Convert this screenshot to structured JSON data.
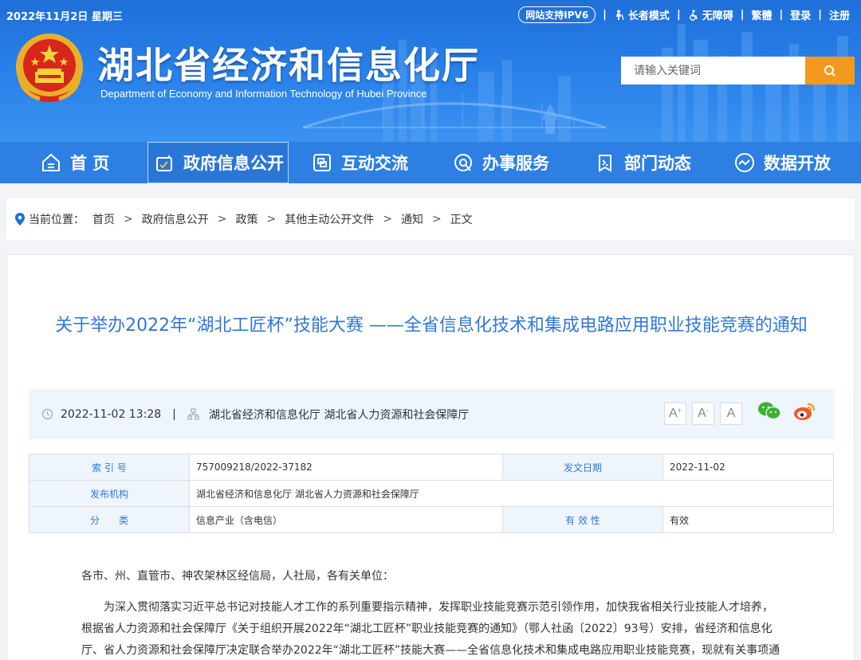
{
  "topbar": {
    "date": "2022年11月2日 星期三",
    "ipv6": "网站支持IPV6",
    "elder": "长者模式",
    "accessible": "无障碍",
    "traditional": "繁體",
    "login": "登录",
    "register": "注册"
  },
  "header": {
    "title": "湖北省经济和信息化厅",
    "subtitle": "Department of Economy and Information Technology of Hubei Province",
    "search_placeholder": "请输入关键词"
  },
  "nav": {
    "items": [
      {
        "label": "首 页",
        "icon": "home-icon"
      },
      {
        "label": "政府信息公开",
        "icon": "info-icon",
        "active": true
      },
      {
        "label": "互动交流",
        "icon": "interact-icon"
      },
      {
        "label": "办事服务",
        "icon": "service-icon"
      },
      {
        "label": "部门动态",
        "icon": "news-icon"
      },
      {
        "label": "数据开放",
        "icon": "data-icon"
      }
    ]
  },
  "breadcrumb": {
    "label": "当前位置：",
    "items": [
      "首页",
      "政府信息公开",
      "政策",
      "其他主动公开文件",
      "通知",
      "正文"
    ]
  },
  "article": {
    "title": "关于举办2022年“湖北工匠杯”技能大赛 ——全省信息化技术和集成电路应用职业技能竞赛的通知",
    "time": "2022-11-02 13:28",
    "source": "湖北省经济和信息化厅 湖北省人力资源和社会保障厅",
    "font_buttons": [
      "A",
      "A",
      "A"
    ]
  },
  "info_table": {
    "index_label": "索 引 号",
    "index_value": "757009218/2022-37182",
    "date_label": "发文日期",
    "date_value": "2022-11-02",
    "org_label": "发布机构",
    "org_value": "湖北省经济和信息化厅 湖北省人力资源和社会保障厅",
    "cat_label": "分　　类",
    "cat_value": "信息产业（含电信）",
    "valid_label": "有 效 性",
    "valid_value": "有效"
  },
  "body": {
    "salutation": "各市、州、直管市、神农架林区经信局，人社局，各有关单位：",
    "para1": "为深入贯彻落实习近平总书记对技能人才工作的系列重要指示精神，发挥职业技能竞赛示范引领作用，加快我省相关行业技能人才培养，根据省人力资源和社会保障厅《关于组织开展2022年“湖北工匠杯”职业技能竞赛的通知》（鄂人社函〔2022〕93号）安排，省经济和信息化厅、省人力资源和社会保障厅决定联合举办2022年“湖北工匠杯”技能大赛——全省信息化技术和集成电路应用职业技能竞赛，现就有关事项通知如下："
  },
  "colors": {
    "header_blue": "#2a82ea",
    "nav_blue": "#2d7fe3",
    "title_blue": "#2f78d8",
    "search_orange": "#f39a1e"
  }
}
